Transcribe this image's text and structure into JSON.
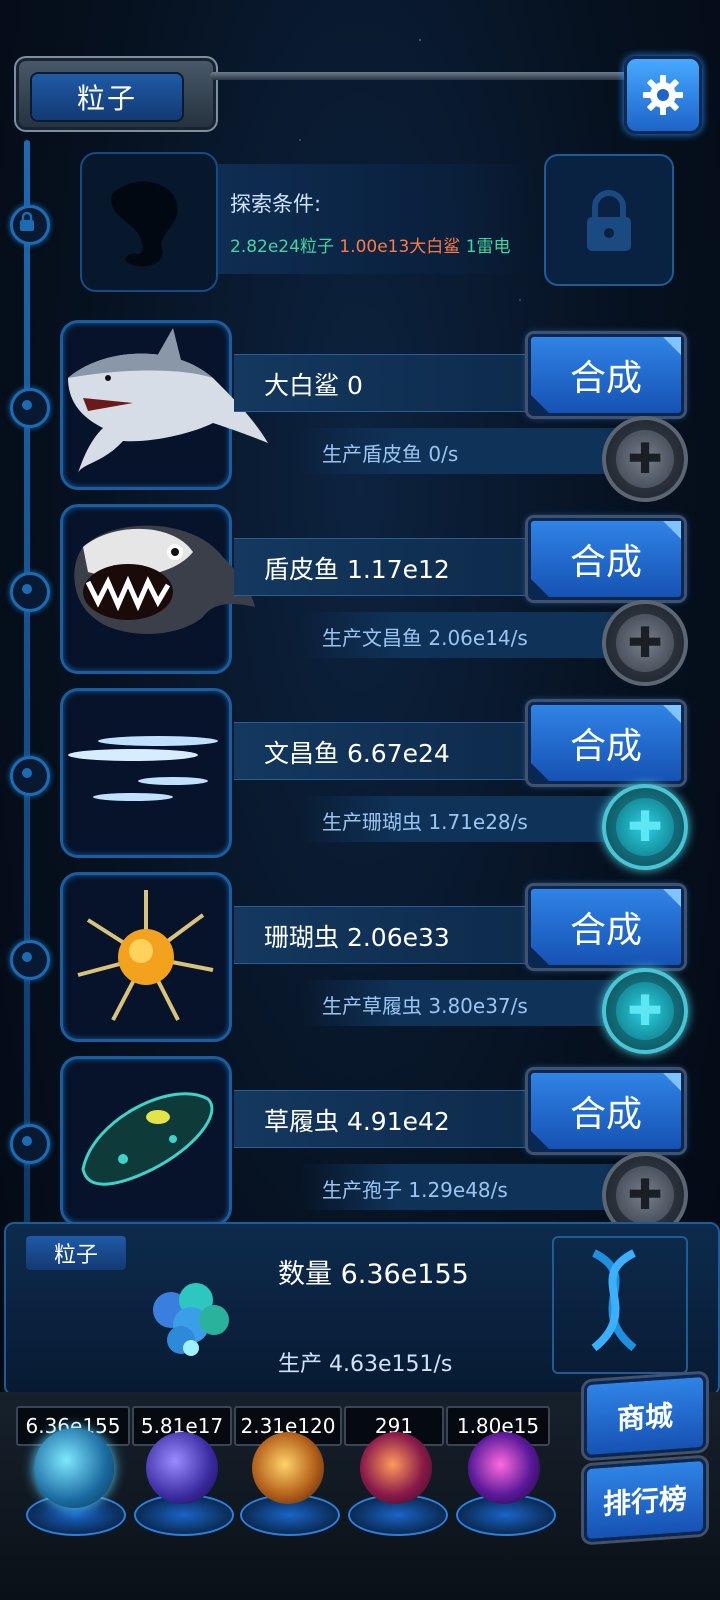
{
  "header": {
    "title": "粒子"
  },
  "locked": {
    "label": "探索条件:",
    "req1": "2.82e24粒子",
    "req2": "1.00e13大白鲨",
    "req3": "1雷电"
  },
  "rows": [
    {
      "name": "大白鲨 0",
      "produce": "生产盾皮鱼 0/s",
      "button": "合成",
      "plus_active": false,
      "icon": "great-white-shark"
    },
    {
      "name": "盾皮鱼 1.17e12",
      "produce": "生产文昌鱼 2.06e14/s",
      "button": "合成",
      "plus_active": false,
      "icon": "placoderm-fish"
    },
    {
      "name": "文昌鱼 6.67e24",
      "produce": "生产珊瑚虫 1.71e28/s",
      "button": "合成",
      "plus_active": true,
      "icon": "lancelet"
    },
    {
      "name": "珊瑚虫 2.06e33",
      "produce": "生产草履虫 3.80e37/s",
      "button": "合成",
      "plus_active": true,
      "icon": "coral-polyp"
    },
    {
      "name": "草履虫 4.91e42",
      "produce": "生产孢子 1.29e48/s",
      "button": "合成",
      "plus_active": false,
      "icon": "paramecium"
    }
  ],
  "panel": {
    "tag": "粒子",
    "count": "数量 6.36e155",
    "rate": "生产 4.63e151/s"
  },
  "resources": [
    "6.36e155",
    "5.81e17",
    "2.31e120",
    "291",
    "1.80e15"
  ],
  "side_buttons": {
    "shop": "商城",
    "rank": "排行榜"
  },
  "colors": {
    "accent": "#2f84e6",
    "green": "#41d7a0",
    "orange": "#ff7a44"
  }
}
